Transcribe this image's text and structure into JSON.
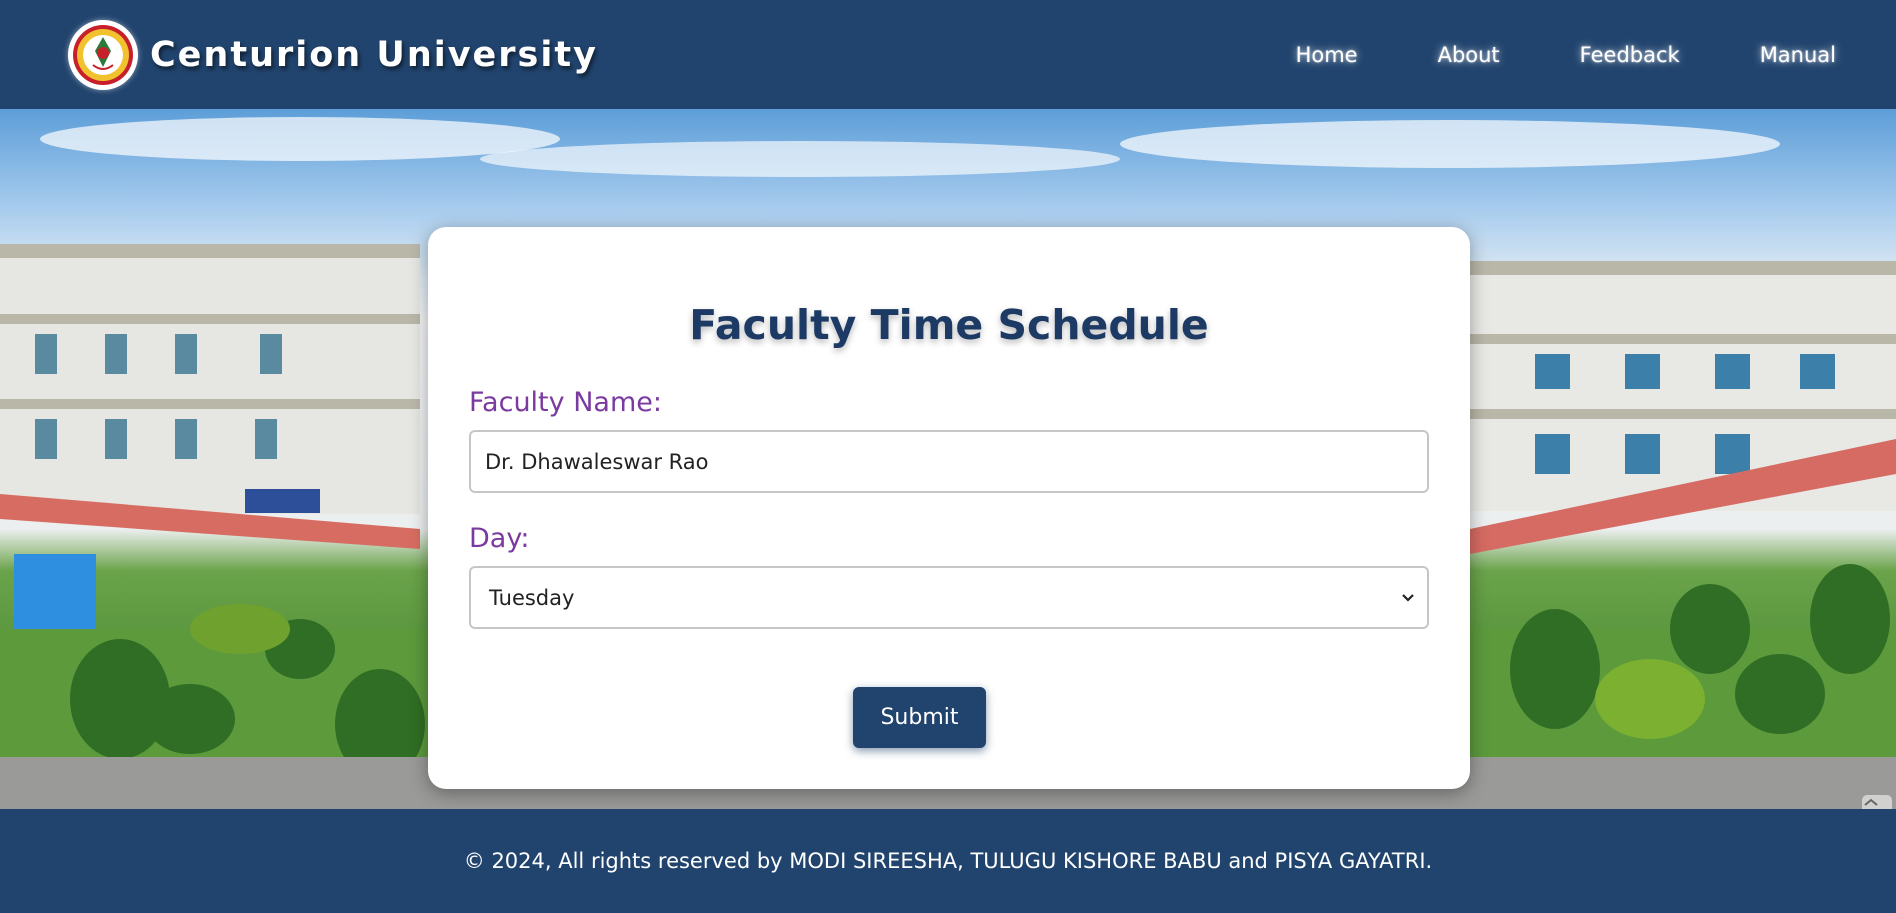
{
  "header": {
    "brand_name": "Centurion University",
    "logo_icon": "university-seal-icon",
    "nav": [
      {
        "label": "Home"
      },
      {
        "label": "About"
      },
      {
        "label": "Feedback"
      },
      {
        "label": "Manual"
      }
    ]
  },
  "form": {
    "title": "Faculty Time Schedule",
    "faculty_label": "Faculty Name:",
    "faculty_value": "Dr. Dhawaleswar Rao",
    "day_label": "Day:",
    "day_value": "Tuesday",
    "submit_label": "Submit"
  },
  "footer": {
    "text": "© 2024, All rights reserved by MODI SIREESHA, TULUGU KISHORE BABU and PISYA GAYATRI."
  },
  "colors": {
    "header_bg": "#21446e",
    "title": "#1c3a64",
    "label": "#7a3aa0"
  }
}
